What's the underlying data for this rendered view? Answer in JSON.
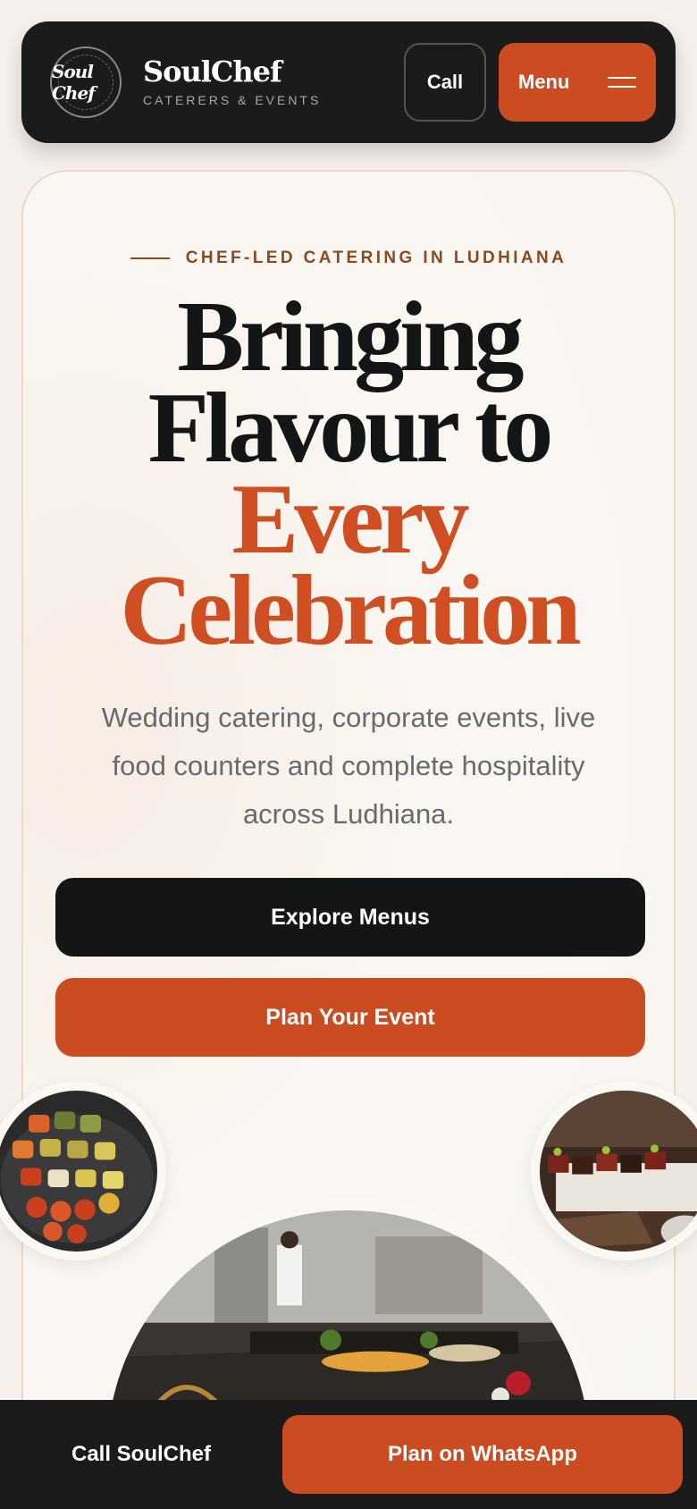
{
  "header": {
    "logo_text": "Soul Chef",
    "brand_name": "SoulChef",
    "brand_tagline": "CATERERS & EVENTS",
    "call_label": "Call",
    "menu_label": "Menu"
  },
  "hero": {
    "eyebrow": "CHEF-LED CATERING IN LUDHIANA",
    "headline_line1": "Bringing",
    "headline_line2": "Flavour to",
    "headline_line3": "Every",
    "headline_line4": "Celebration",
    "subtitle": "Wedding catering, corporate events, live food counters and complete hospitality across Ludhiana.",
    "primary_cta": "Explore Menus",
    "secondary_cta": "Plan Your Event"
  },
  "bottom_bar": {
    "call_label": "Call SoulChef",
    "whatsapp_label": "Plan on WhatsApp"
  },
  "colors": {
    "accent": "#cc4c22",
    "dark": "#1b1b1b",
    "eyebrow": "#8a4a1e",
    "background": "#f6f1ec"
  },
  "icons": {
    "menu": "hamburger-icon"
  }
}
